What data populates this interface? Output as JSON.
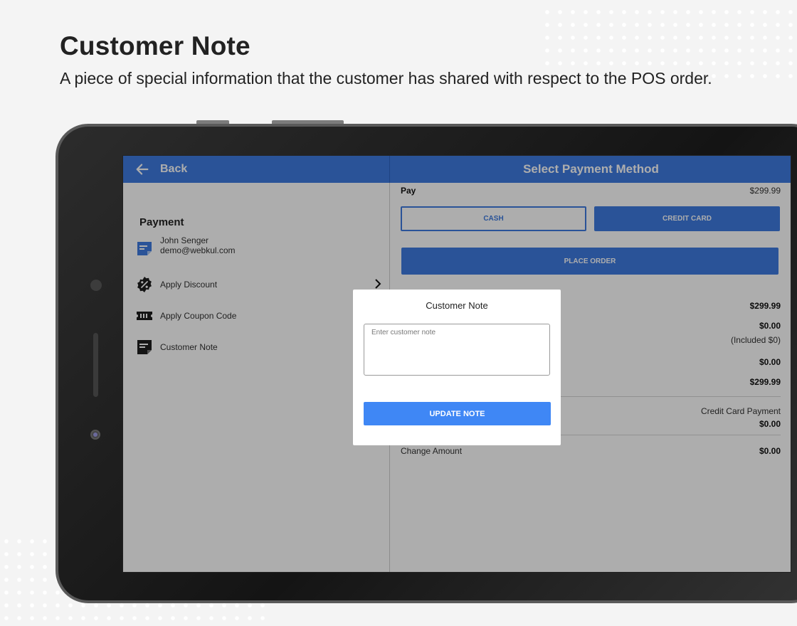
{
  "heading": {
    "title": "Customer Note",
    "subtitle": "A piece of special information that the customer has shared with respect to the POS order."
  },
  "topbar": {
    "back_label": "Back",
    "title": "Select Payment Method"
  },
  "left": {
    "section_title": "Payment",
    "customer": {
      "name": "John Senger",
      "email": "demo@webkul.com"
    },
    "menu": [
      {
        "label": "Apply Discount",
        "icon": "discount-badge-icon"
      },
      {
        "label": "Apply Coupon Code",
        "icon": "coupon-ticket-icon"
      },
      {
        "label": "Customer Note",
        "icon": "note-icon"
      }
    ]
  },
  "right": {
    "pay_label": "Pay",
    "pay_amount": "$299.99",
    "cash_label": "CASH",
    "credit_card_label": "CREDIT CARD",
    "place_order_label": "PLACE ORDER",
    "summary_values": [
      "$299.99",
      "$0.00",
      "(Included $0)",
      "$0.00",
      "$299.99"
    ],
    "payment_label": "Credit Card Payment",
    "payment_value": "$0.00",
    "change_label": "Change Amount",
    "change_value": "$0.00"
  },
  "modal": {
    "title": "Customer Note",
    "input_value": "",
    "input_placeholder": "Enter customer note",
    "update_label": "UPDATE NOTE"
  },
  "colors": {
    "accent": "#3f7be0",
    "update_button": "#3f87f5",
    "page_background": "#f4f4f4"
  }
}
